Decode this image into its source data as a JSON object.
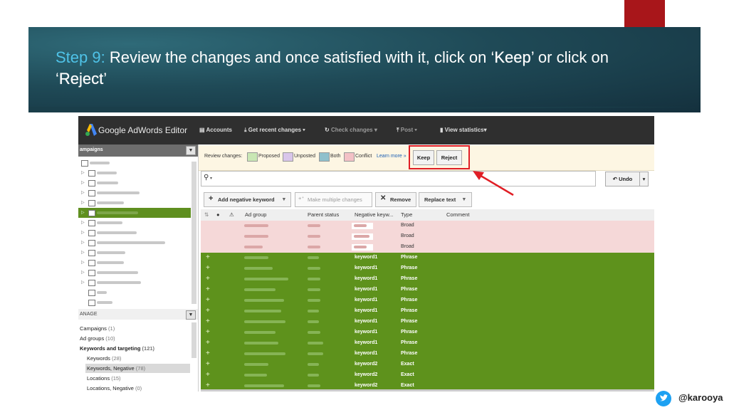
{
  "slide": {
    "step_label": "Step 9:",
    "title_part1": " Review the changes and once satisfied with it, click on ‘",
    "keep_word": "Keep",
    "title_part2": "’ or click on ‘",
    "reject_word": "Reject",
    "title_part3": "’",
    "handle": "@karooya",
    "colors": {
      "banner": "#1f4a57",
      "step": "#4fc3e8",
      "red_tab": "#a8161a",
      "highlight": "#e01e25"
    }
  },
  "app": {
    "name": "Google AdWords Editor",
    "toolbar": [
      "Accounts",
      "Get recent changes",
      "Check changes",
      "Post",
      "View statistics"
    ],
    "toolbar_icons": [
      "accounts-icon",
      "download-icon",
      "refresh-icon",
      "upload-icon",
      "bar-chart-icon"
    ]
  },
  "left_panel": {
    "header": "ampaigns",
    "manage_header": "ANAGE",
    "manage_items": [
      {
        "label": "Campaigns",
        "count": "(1)"
      },
      {
        "label": "Ad groups",
        "count": "(10)"
      },
      {
        "label": "Keywords and targeting",
        "count": "(121)"
      },
      {
        "label": "Keywords",
        "count": "(28)"
      },
      {
        "label": "Keywords, Negative",
        "count": "(78)"
      },
      {
        "label": "Locations",
        "count": "(15)"
      },
      {
        "label": "Locations, Negative",
        "count": "(0)"
      }
    ]
  },
  "review_bar": {
    "label": "Review changes:",
    "legend": [
      "Proposed",
      "Unposted",
      "Both",
      "Conflict"
    ],
    "legend_colors": [
      "#c9e7b4",
      "#d9c6ea",
      "#8fc0cc",
      "#f3c1c6"
    ],
    "learn_more": "Learn more »",
    "keep": "Keep",
    "reject": "Reject"
  },
  "search": {
    "placeholder": ""
  },
  "undo": "Undo",
  "actions": {
    "add_negative": "Add negative keyword",
    "make_multiple": "Make multiple changes",
    "remove": "Remove",
    "replace_text": "Replace text"
  },
  "grid": {
    "columns": [
      "Ad group",
      "Parent status",
      "Negative keyw...",
      "Type",
      "Comment"
    ],
    "pink_rows": [
      {
        "type": "Broad"
      },
      {
        "type": "Broad"
      },
      {
        "type": "Broad"
      }
    ],
    "green_rows": [
      {
        "keyword": "keyword1",
        "type": "Phrase"
      },
      {
        "keyword": "keyword1",
        "type": "Phrase"
      },
      {
        "keyword": "keyword1",
        "type": "Phrase"
      },
      {
        "keyword": "keyword1",
        "type": "Phrase"
      },
      {
        "keyword": "keyword1",
        "type": "Phrase"
      },
      {
        "keyword": "keyword1",
        "type": "Phrase"
      },
      {
        "keyword": "keyword1",
        "type": "Phrase"
      },
      {
        "keyword": "keyword1",
        "type": "Phrase"
      },
      {
        "keyword": "keyword1",
        "type": "Phrase"
      },
      {
        "keyword": "keyword1",
        "type": "Phrase"
      },
      {
        "keyword": "keyword2",
        "type": "Exact"
      },
      {
        "keyword": "keyword2",
        "type": "Exact"
      },
      {
        "keyword": "keyword2",
        "type": "Exact"
      }
    ]
  }
}
